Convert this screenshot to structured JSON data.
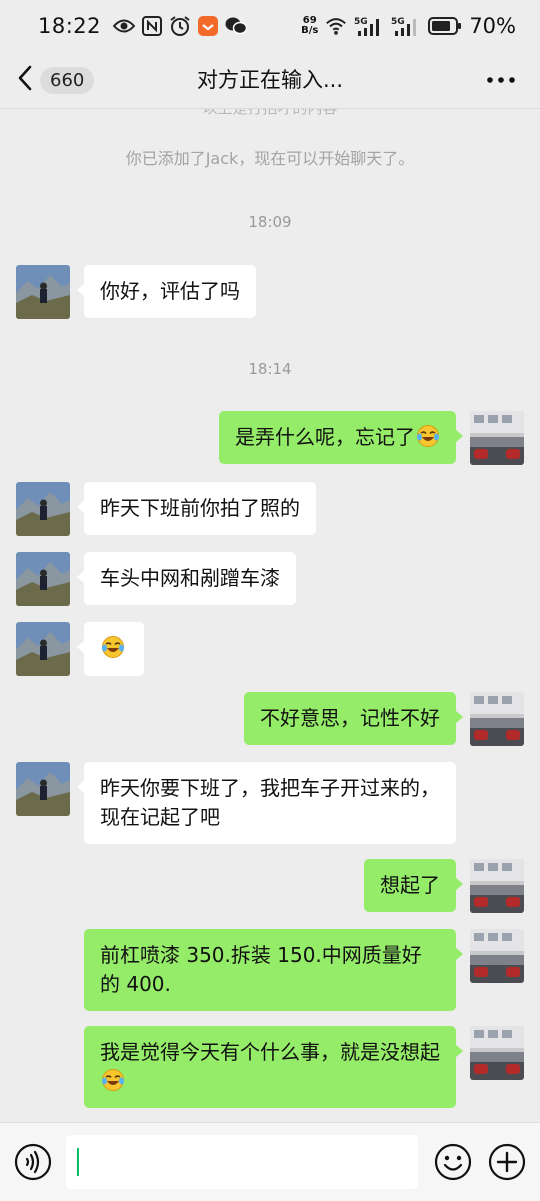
{
  "status_bar": {
    "time": "18:22",
    "net_speed_value": "69",
    "net_speed_unit": "B/s",
    "signal1_label": "5G",
    "signal2_label": "5G",
    "battery": "70%"
  },
  "nav": {
    "unread_count": "660",
    "title": "对方正在输入..."
  },
  "chat": {
    "faded_system_text": "以上是打招呼的内容",
    "system_notice": "你已添加了Jack，现在可以开始聊天了。",
    "timestamps": [
      "18:09",
      "18:14"
    ],
    "messages": [
      {
        "from": "them",
        "text": "你好，评估了吗"
      },
      {
        "from": "me",
        "text": "是弄什么呢，忘记了",
        "emoji": "laugh-cry"
      },
      {
        "from": "them",
        "text": "昨天下班前你拍了照的"
      },
      {
        "from": "them",
        "text": "车头中网和剐蹭车漆"
      },
      {
        "from": "them",
        "text": "",
        "emoji": "laugh-cry"
      },
      {
        "from": "me",
        "text": "不好意思，记性不好"
      },
      {
        "from": "them",
        "text": "昨天你要下班了，我把车子开过来的，现在记起了吧"
      },
      {
        "from": "me",
        "text": "想起了"
      },
      {
        "from": "me",
        "text": "前杠喷漆 350.拆装 150.中网质量好的 400."
      },
      {
        "from": "me",
        "text": "我是觉得今天有个什么事，就是没想起",
        "emoji": "laugh-cry"
      }
    ]
  },
  "input_bar": {
    "text_value": "",
    "icons": [
      "voice-icon",
      "emoji-icon",
      "plus-icon"
    ]
  },
  "colors": {
    "background": "#ededed",
    "outgoing_bubble": "#95ec69",
    "incoming_bubble": "#ffffff",
    "accent": "#07c160"
  }
}
